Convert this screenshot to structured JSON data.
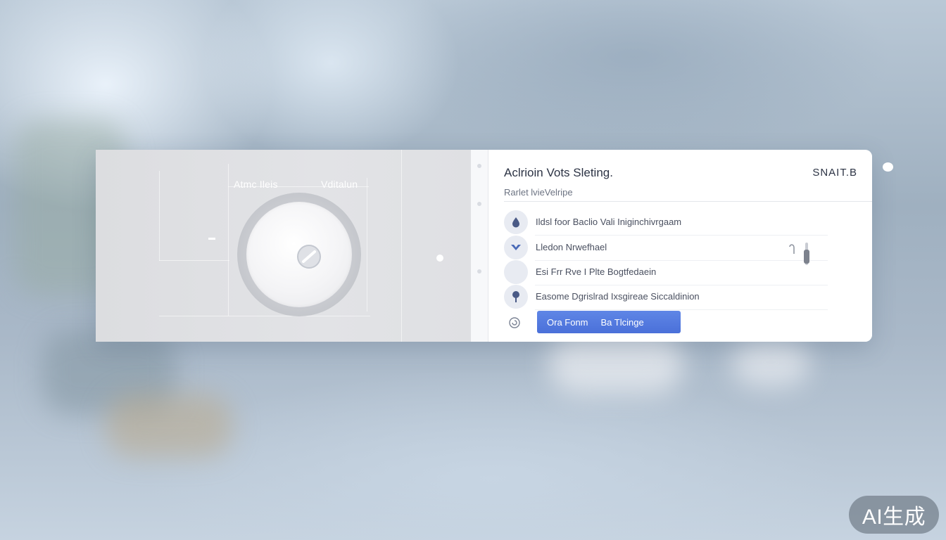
{
  "visual": {
    "left_label": "Atmc Ileis",
    "right_label": "Vditalun"
  },
  "panel": {
    "title": "Aclrioin Vots Sleting.",
    "subtitle": "Rarlet lvieVelripe",
    "brand": "SNAIT.B"
  },
  "list": [
    {
      "icon": "drop-icon",
      "label": "Ildsl foor Baclio Vali Iniginchivrgaam"
    },
    {
      "icon": "chevron-down-icon",
      "label": "Lledon Nrwefhael"
    },
    {
      "icon": "blank-icon",
      "label": "Esi Frr Rve I Plte Bogtfedaein"
    },
    {
      "icon": "pin-icon",
      "label": "Easome Dgrislrad Ixsgireae Siccaldinion"
    }
  ],
  "actions": {
    "primary_part1": "Ora Fonm",
    "primary_part2": "Ba Tlcinge"
  },
  "watermark": "AI生成",
  "colors": {
    "accent": "#4f76dd",
    "title_text": "#2c3344",
    "icon_bg": "#e8ebf2"
  }
}
